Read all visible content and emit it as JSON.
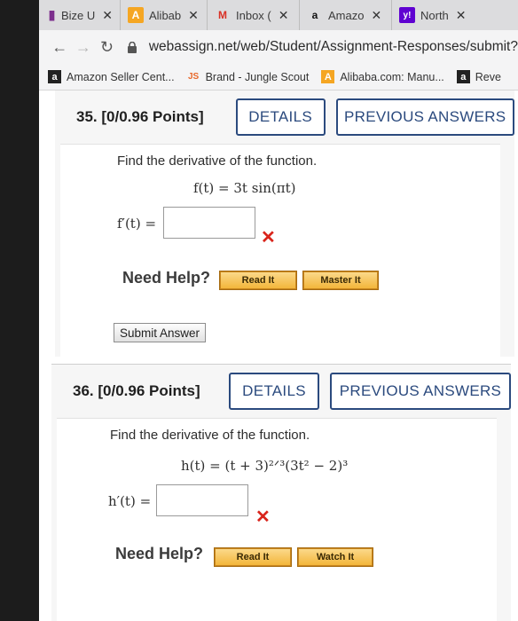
{
  "tabs": [
    {
      "icon": "stripes-icon",
      "label": "Bize U",
      "close": "✕"
    },
    {
      "icon": "alibaba-icon",
      "label": "Alibab",
      "close": "✕"
    },
    {
      "icon": "gmail-icon",
      "label": "Inbox (",
      "close": "✕"
    },
    {
      "icon": "amazon-icon",
      "label": "Amazo",
      "close": "✕"
    },
    {
      "icon": "yahoo-icon",
      "label": "North",
      "close": "✕"
    }
  ],
  "address_bar": {
    "url": "webassign.net/web/Student/Assignment-Responses/submit?"
  },
  "bookmarks": [
    {
      "icon": "amazon-icon",
      "label": "Amazon Seller Cent..."
    },
    {
      "icon": "jungle-scout-icon",
      "label": "Brand - Jungle Scout"
    },
    {
      "icon": "alibaba-icon",
      "label": "Alibaba.com: Manu..."
    },
    {
      "icon": "amazon-icon",
      "label": "Reve"
    }
  ],
  "questions": [
    {
      "number": "35.  [0/0.96 Points]",
      "details": "DETAILS",
      "previous": "PREVIOUS ANSWERS",
      "prompt": "Find the derivative of the function.",
      "formula": "f(t) = 3t sin(πt)",
      "answer_label": "f′(t) =",
      "answer_value": "",
      "result": "✕",
      "need_help": "Need Help?",
      "help_buttons": [
        "Read It",
        "Master It"
      ],
      "submit": "Submit Answer"
    },
    {
      "number": "36.  [0/0.96 Points]",
      "details": "DETAILS",
      "previous": "PREVIOUS ANSWERS",
      "prompt": "Find the derivative of the function.",
      "formula": "h(t) = (t + 3)²ᐟ³(3t² − 2)³",
      "answer_label": "h′(t) =",
      "answer_value": "",
      "result": "✕",
      "need_help": "Need Help?",
      "help_buttons": [
        "Read It",
        "Watch It"
      ]
    }
  ]
}
